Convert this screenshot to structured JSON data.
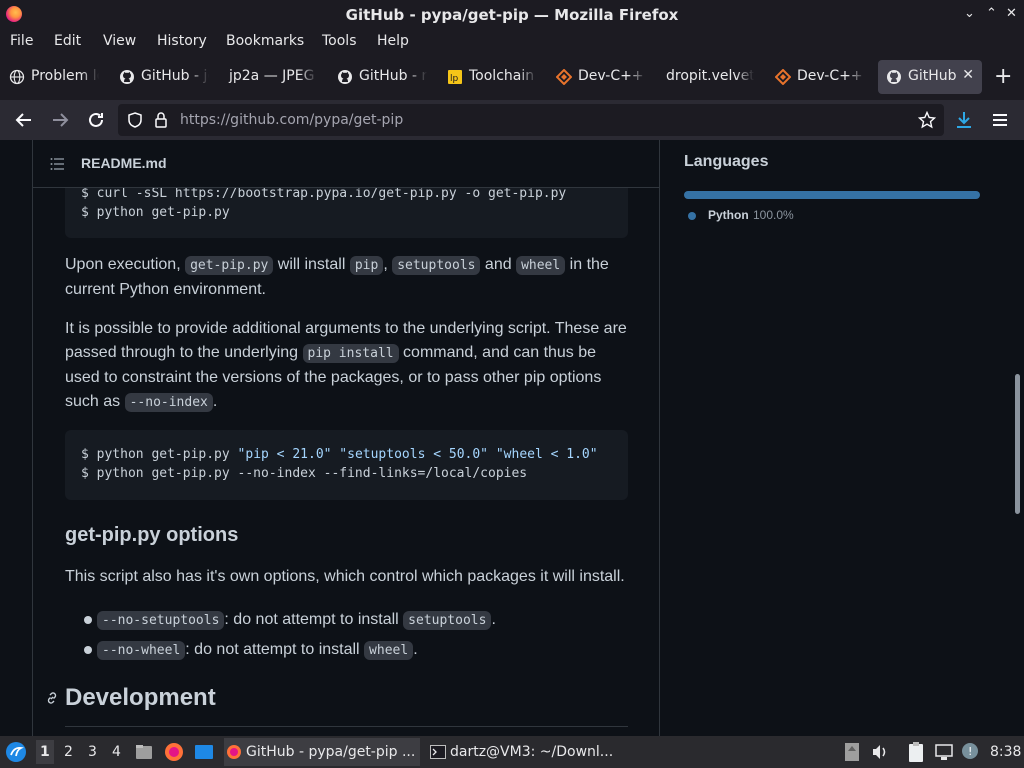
{
  "window": {
    "title": "GitHub - pypa/get-pip — Mozilla Firefox",
    "controls": [
      "⌄",
      "⌃",
      "✕"
    ]
  },
  "menu": [
    "File",
    "Edit",
    "View",
    "History",
    "Bookmarks",
    "Tools",
    "Help"
  ],
  "tabs": [
    {
      "label": "Problem lo",
      "icon": "globe-icon"
    },
    {
      "label": "GitHub - jc",
      "icon": "github-icon"
    },
    {
      "label": "jp2a — JPEG t",
      "icon": ""
    },
    {
      "label": "GitHub - r",
      "icon": "github-icon"
    },
    {
      "label": "Toolchain",
      "icon": "toolchain-icon"
    },
    {
      "label": "Dev-C++",
      "icon": "devcpp-icon"
    },
    {
      "label": "dropit.velvet",
      "icon": ""
    },
    {
      "label": "Dev-C++",
      "icon": "devcpp-icon"
    },
    {
      "label": "GitHub",
      "icon": "github-icon",
      "active": true
    }
  ],
  "tab_close": "✕",
  "new_tab": "+",
  "url": {
    "host": "https://github.com",
    "path": "/pypa/get-pip"
  },
  "readme": {
    "filename": "README.md",
    "code1": [
      "$ curl -sSL https://bootstrap.pypa.io/get-pip.py -o get-pip.py",
      "$ python get-pip.py"
    ],
    "para1": {
      "t1": "Upon execution, ",
      "c1": "get-pip.py",
      "t2": " will install ",
      "c2": "pip",
      "t3": ", ",
      "c3": "setuptools",
      "t4": " and ",
      "c4": "wheel",
      "t5": " in the current Python environment."
    },
    "para2": {
      "t1": "It is possible to provide additional arguments to the underlying script. These are passed through to the underlying ",
      "c1": "pip install",
      "t2": " command, and can thus be used to constraint the versions of the packages, or to pass other pip options such as ",
      "c2": "--no-index",
      "t3": "."
    },
    "code2": {
      "line1_prefix": "$ python get-pip.py ",
      "line1_s1": "\"pip < 21.0\"",
      "line1_s2": "\"setuptools < 50.0\"",
      "line1_s3": "\"wheel < 1.0\"",
      "line2": "$ python get-pip.py --no-index --find-links=/local/copies"
    },
    "options_heading": "get-pip.py options",
    "options_intro": "This script also has it's own options, which control which packages it will install.",
    "options": [
      {
        "flag": "--no-setuptools",
        "text": ": do not attempt to install ",
        "pkg": "setuptools",
        "end": "."
      },
      {
        "flag": "--no-wheel",
        "text": ": do not attempt to install ",
        "pkg": "wheel",
        "end": "."
      }
    ],
    "dev_heading": "Development"
  },
  "languages": {
    "title": "Languages",
    "items": [
      {
        "name": "Python",
        "percent": "100.0%",
        "fraction": 1.0,
        "color": "#3572a5"
      }
    ]
  },
  "taskbar": {
    "workspaces": [
      "1",
      "2",
      "3",
      "4"
    ],
    "tasks": [
      "GitHub - pypa/get-pip ...",
      "dartz@VM3: ~/Downl..."
    ],
    "clock": "8:38"
  }
}
